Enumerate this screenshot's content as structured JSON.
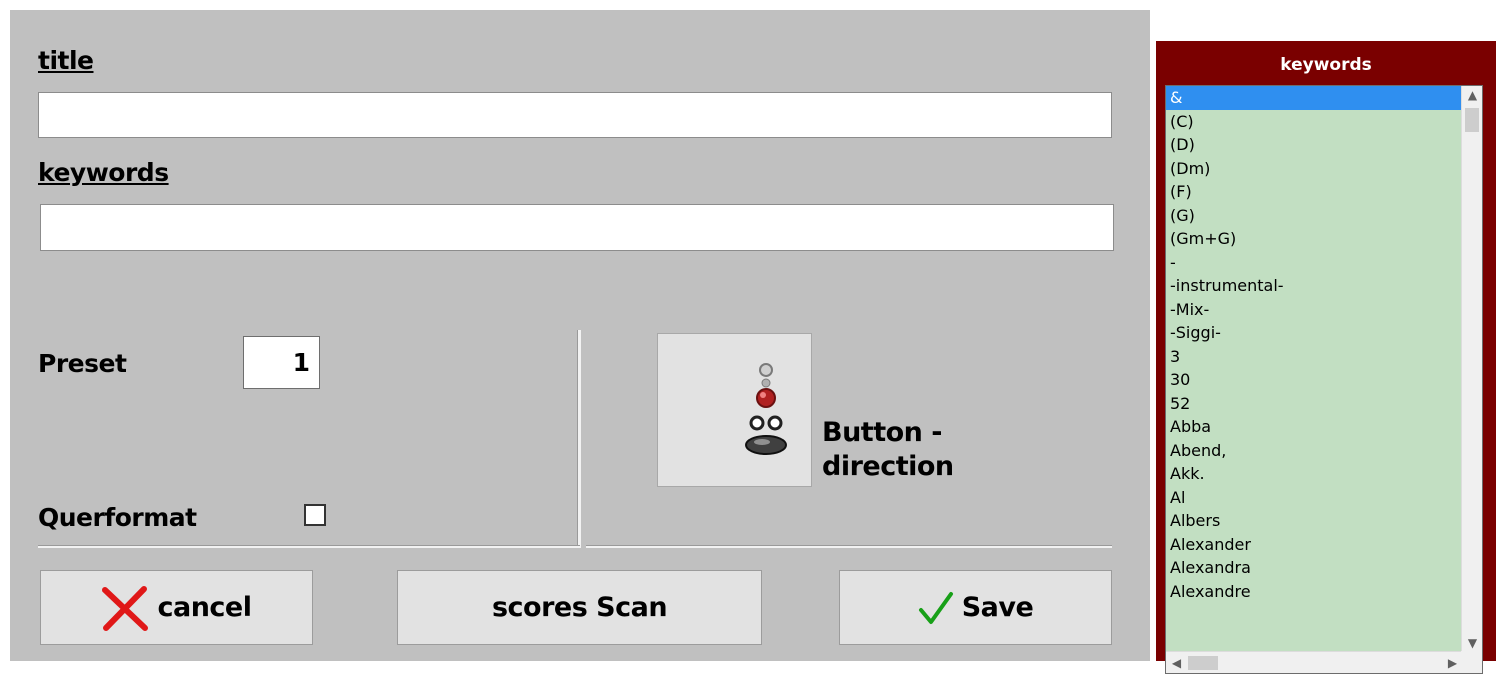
{
  "form": {
    "title_label": "title",
    "title_value": "",
    "keywords_label": "keywords",
    "keywords_value": "",
    "preset_label": "Preset",
    "preset_value": "1",
    "querformat_label": "Querformat",
    "querformat_checked": false,
    "direction_label_line1": "Button -",
    "direction_label_line2": "direction"
  },
  "buttons": {
    "cancel": "cancel",
    "scan": "scores Scan",
    "save": "Save"
  },
  "keyword_panel": {
    "title": "keywords",
    "selected_index": 0,
    "items": [
      "&",
      "(C)",
      "(D)",
      "(Dm)",
      "(F)",
      "(G)",
      "(Gm+G)",
      "-",
      "-instrumental-",
      "-Mix-",
      "-Siggi-",
      "3",
      "30",
      "52",
      "Abba",
      "Abend,",
      "Akk.",
      "Al",
      "Albers",
      "Alexander",
      "Alexandra",
      "Alexandre"
    ]
  },
  "colors": {
    "panel_bg": "#c0c0c0",
    "keyword_frame": "#7a0000",
    "list_bg": "#c2dfc2",
    "selection": "#2f8ff0",
    "cancel_icon": "#e01818",
    "save_icon": "#18a018"
  },
  "icons": {
    "cancel": "x-icon",
    "save": "checkmark-icon",
    "direction": "button-direction-icon"
  }
}
